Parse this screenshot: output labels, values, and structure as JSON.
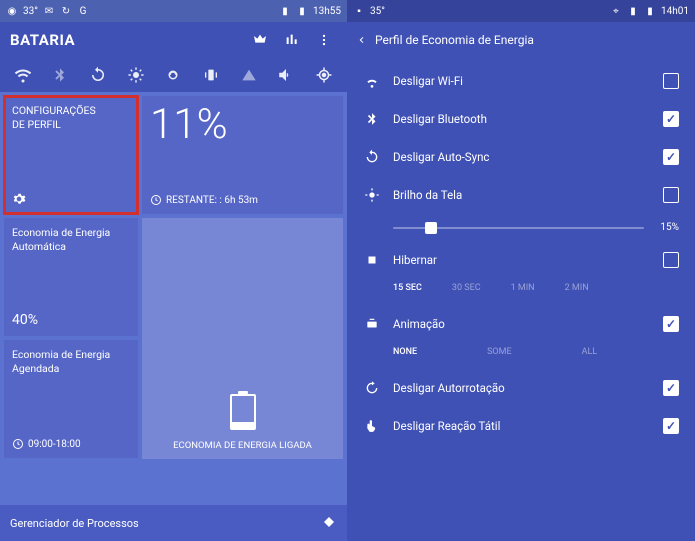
{
  "left": {
    "statusbar": {
      "time": "13h55",
      "temp": "33°"
    },
    "appbar": {
      "title": "BATARIA"
    },
    "tiles": {
      "profile": {
        "title": "CONFIGURAÇÕES\nDE PERFIL"
      },
      "battery": {
        "pct": "11%",
        "remaining": "RESTANTE: : 6h 53m"
      },
      "auto": {
        "title": "Economia de Energia\nAutomática",
        "pct": "40%"
      },
      "scheduled": {
        "title": "Economia de Energia Agendada",
        "time": "09:00-18:00"
      },
      "eco": {
        "label": "ECONOMIA DE ENERGIA LIGADA"
      }
    },
    "bottom": {
      "label": "Gerenciador de Processos"
    }
  },
  "right": {
    "statusbar": {
      "time": "14h01",
      "temp": "35°"
    },
    "appbar": {
      "title": "Perfil de Economia de Energia"
    },
    "settings": {
      "wifi": {
        "label": "Desligar Wi-Fi",
        "checked": false
      },
      "bluetooth": {
        "label": "Desligar Bluetooth",
        "checked": true
      },
      "autosync": {
        "label": "Desligar Auto-Sync",
        "checked": true
      },
      "brightness": {
        "label": "Brilho da Tela",
        "checked": false,
        "value": "15%"
      },
      "hibernate": {
        "label": "Hibernar",
        "checked": false,
        "options": [
          "15 SEC",
          "30 SEC",
          "1 MIN",
          "2 MIN"
        ],
        "active": "15 SEC"
      },
      "animation": {
        "label": "Animação",
        "checked": true,
        "options": [
          "NONE",
          "SOME",
          "ALL"
        ],
        "active": "NONE"
      },
      "autorotate": {
        "label": "Desligar Autorrotação",
        "checked": true
      },
      "haptic": {
        "label": "Desligar Reação Tátil",
        "checked": true
      }
    }
  }
}
